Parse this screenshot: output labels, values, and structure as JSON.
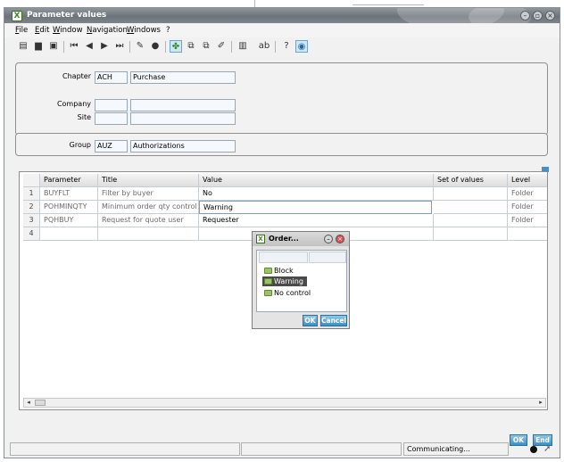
{
  "window": {
    "title": "Parameter values"
  },
  "menu": [
    "File",
    "Edit",
    "Window",
    "Navigation",
    "Windows",
    "?"
  ],
  "header": {
    "chapter_label": "Chapter",
    "chapter_code": "ACH",
    "chapter_desc": "Purchase",
    "company_label": "Company",
    "company_code": "",
    "company_desc": "",
    "site_label": "Site",
    "site_code": "",
    "site_desc": ""
  },
  "group": {
    "label": "Group",
    "code": "AUZ",
    "desc": "Authorizations"
  },
  "grid": {
    "columns": [
      "Parameter",
      "Title",
      "Value",
      "Set of values",
      "Level"
    ],
    "rows": [
      {
        "num": "1",
        "parameter": "BUYFLT",
        "title": "Filter by buyer",
        "value": "No",
        "set": "",
        "level": "Folder"
      },
      {
        "num": "2",
        "parameter": "POHMINQTY",
        "title": "Minimum order qty control",
        "value": "Warning",
        "set": "",
        "level": "Folder"
      },
      {
        "num": "3",
        "parameter": "PQHBUY",
        "title": "Request for quote user",
        "value": "Requester",
        "set": "",
        "level": "Folder"
      },
      {
        "num": "4",
        "parameter": "",
        "title": "",
        "value": "",
        "set": "",
        "level": ""
      }
    ]
  },
  "popup": {
    "title": "Order...",
    "items": [
      "Block",
      "Warning",
      "No control"
    ],
    "selected": "Warning",
    "ok_label": "OK",
    "cancel_label": "Cancel"
  },
  "footer": {
    "ok_label": "OK",
    "end_label": "End"
  },
  "status": {
    "text": "Communicating..."
  }
}
